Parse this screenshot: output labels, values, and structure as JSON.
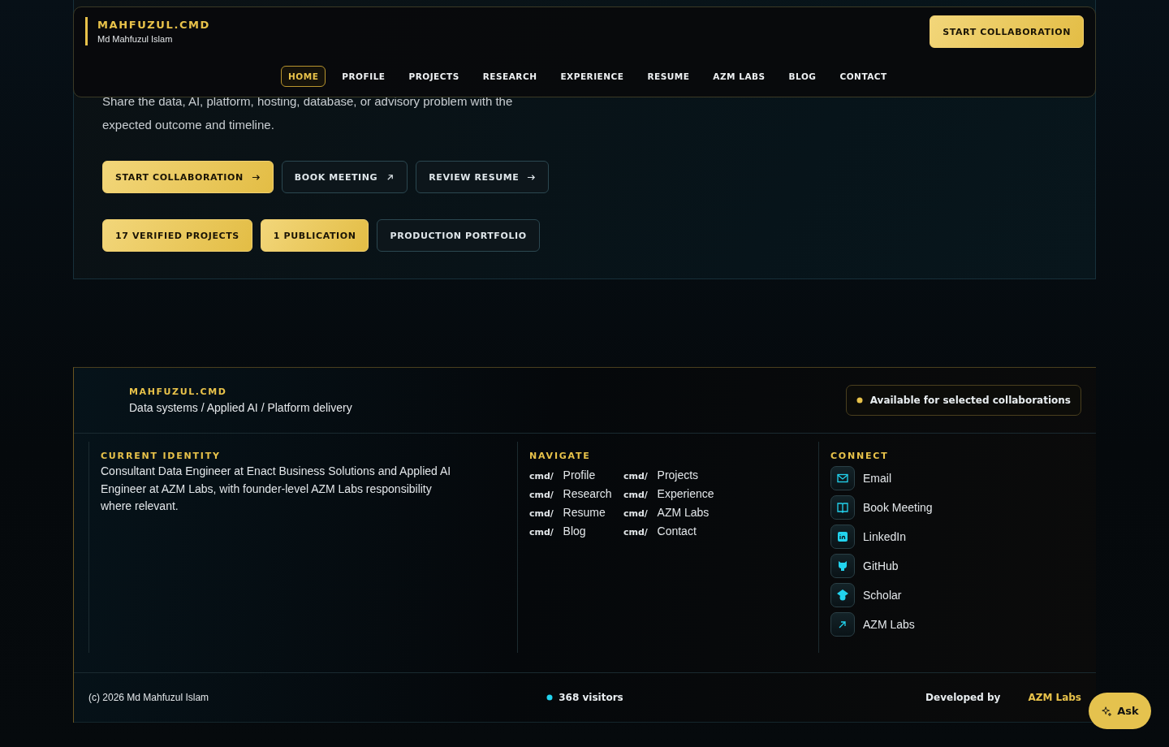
{
  "header": {
    "brand": "MAHFUZUL.CMD",
    "subtitle": "Md Mahfuzul Islam",
    "cta": "START COLLABORATION",
    "nav": [
      {
        "label": "HOME",
        "selected": true
      },
      {
        "label": "PROFILE",
        "selected": false
      },
      {
        "label": "PROJECTS",
        "selected": false
      },
      {
        "label": "RESEARCH",
        "selected": false
      },
      {
        "label": "EXPERIENCE",
        "selected": false
      },
      {
        "label": "RESUME",
        "selected": false
      },
      {
        "label": "AZM LABS",
        "selected": false
      },
      {
        "label": "BLOG",
        "selected": false
      },
      {
        "label": "CONTACT",
        "selected": false
      }
    ]
  },
  "hero": {
    "text": "Share the data, AI, platform, hosting, database, or advisory problem with the expected outcome and timeline.",
    "actions": [
      {
        "label": "START COLLABORATION",
        "kind": "primary"
      },
      {
        "label": "BOOK MEETING",
        "kind": "external"
      },
      {
        "label": "REVIEW RESUME",
        "kind": "link"
      }
    ],
    "chips": [
      {
        "label": "17 VERIFIED PROJECTS",
        "kind": "primary"
      },
      {
        "label": "1 PUBLICATION",
        "kind": "primary"
      },
      {
        "label": "PRODUCTION PORTFOLIO",
        "kind": "outline"
      }
    ]
  },
  "footer": {
    "brand": "MAHFUZUL.CMD",
    "tagline": "Data systems / Applied AI / Platform delivery",
    "availability": "Available for selected collaborations",
    "identity": {
      "heading": "CURRENT IDENTITY",
      "text": "Consultant Data Engineer at Enact Business Solutions and Applied AI Engineer at AZM Labs, with founder-level AZM Labs responsibility where relevant."
    },
    "navigate": {
      "heading": "NAVIGATE",
      "items": [
        {
          "prefix": "cmd/",
          "label": "Profile"
        },
        {
          "prefix": "cmd/",
          "label": "Projects"
        },
        {
          "prefix": "cmd/",
          "label": "Research"
        },
        {
          "prefix": "cmd/",
          "label": "Experience"
        },
        {
          "prefix": "cmd/",
          "label": "Resume"
        },
        {
          "prefix": "cmd/",
          "label": "AZM Labs"
        },
        {
          "prefix": "cmd/",
          "label": "Blog"
        },
        {
          "prefix": "cmd/",
          "label": "Contact"
        }
      ]
    },
    "connect": {
      "heading": "CONNECT",
      "items": [
        {
          "label": "Email",
          "kind": "mail"
        },
        {
          "label": "Book Meeting",
          "kind": "book"
        },
        {
          "label": "LinkedIn",
          "kind": "linkedin"
        },
        {
          "label": "GitHub",
          "kind": "github"
        },
        {
          "label": "Scholar",
          "kind": "scholar"
        },
        {
          "label": "AZM Labs",
          "kind": "external"
        }
      ]
    },
    "copyright": "(c) 2026 Md Mahfuzul Islam",
    "visitors": "368 visitors",
    "developed_by": "Developed by",
    "developer": "AZM Labs"
  },
  "ask": "Ask"
}
